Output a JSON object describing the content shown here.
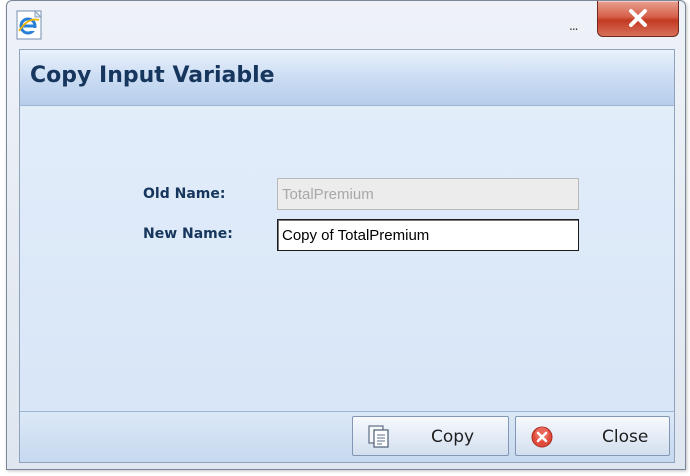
{
  "window": {
    "browser_icon": "ie-icon",
    "ellipsis": "...",
    "close_icon": "close-icon"
  },
  "dialog": {
    "title": "Copy Input Variable",
    "fields": {
      "old_name_label": "Old Name:",
      "old_name_value": "TotalPremium",
      "new_name_label": "New Name:",
      "new_name_value": "Copy of TotalPremium"
    },
    "buttons": {
      "copy_label": "Copy",
      "copy_icon": "copy-icon",
      "close_label": "Close",
      "close_icon": "close-circle-icon"
    }
  },
  "colors": {
    "title_text": "#17365d",
    "close_button": "#c23a22",
    "dialog_bg": "#d8e6f7"
  }
}
